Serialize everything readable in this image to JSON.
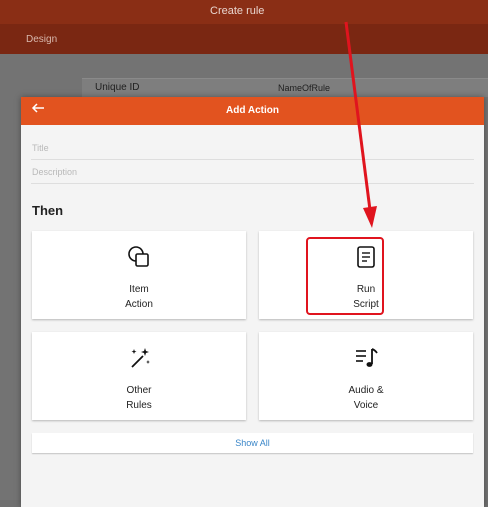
{
  "app": {
    "title": "Create rule",
    "tab": "Design",
    "rule_id_label": "Unique ID",
    "rule_id_value": "NameOfRule"
  },
  "modal": {
    "title": "Add Action",
    "back_icon": "arrow-left-icon",
    "title_placeholder": "Title",
    "description_placeholder": "Description",
    "section_heading": "Then",
    "cards": [
      {
        "line1": "Item",
        "line2": "Action",
        "icon": "shapes-icon"
      },
      {
        "line1": "Run",
        "line2": "Script",
        "icon": "script-icon"
      },
      {
        "line1": "Other",
        "line2": "Rules",
        "icon": "magic-wand-icon"
      },
      {
        "line1": "Audio &",
        "line2": "Voice",
        "icon": "music-list-icon"
      }
    ],
    "show_all": "Show All"
  },
  "colors": {
    "header": "#8a2e15",
    "modal_header": "#e2531f",
    "highlight": "#e0141e",
    "link": "#3a86c8"
  }
}
